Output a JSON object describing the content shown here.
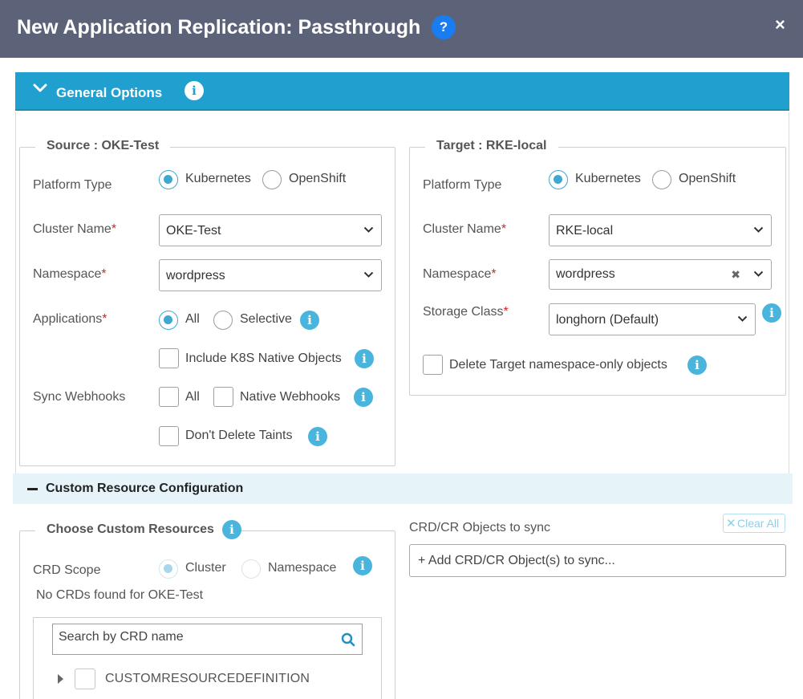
{
  "dialog": {
    "title": "New Application Replication: Passthrough",
    "help_glyph": "?",
    "close_glyph": "×"
  },
  "general_options": {
    "title": "General Options",
    "info_glyph": "i"
  },
  "source": {
    "legend": "Source : OKE-Test",
    "platform_type_label": "Platform Type",
    "platform_options": [
      "Kubernetes",
      "OpenShift"
    ],
    "platform_selected": "Kubernetes",
    "cluster_name_label": "Cluster Name",
    "cluster_name_value": "OKE-Test",
    "namespace_label": "Namespace",
    "namespace_value": "wordpress",
    "applications_label": "Applications",
    "applications_options": [
      "All",
      "Selective"
    ],
    "applications_selected": "All",
    "include_native_label": "Include K8S Native Objects",
    "sync_webhooks_label": "Sync Webhooks",
    "sync_webhooks_all": "All",
    "sync_webhooks_native": "Native Webhooks",
    "dont_delete_taints_label": "Don't Delete Taints",
    "required_mark": "*"
  },
  "target": {
    "legend": "Target : RKE-local",
    "platform_type_label": "Platform Type",
    "platform_options": [
      "Kubernetes",
      "OpenShift"
    ],
    "platform_selected": "Kubernetes",
    "cluster_name_label": "Cluster Name",
    "cluster_name_value": "RKE-local",
    "namespace_label": "Namespace",
    "namespace_value": "wordpress",
    "namespace_clear_glyph": "✖",
    "storage_class_label": "Storage Class",
    "storage_class_value": "longhorn (Default)",
    "delete_target_only_label": "Delete Target namespace-only objects"
  },
  "custom_resource_config": {
    "title": "Custom Resource Configuration",
    "choose_legend": "Choose Custom Resources",
    "crd_scope_label": "CRD Scope",
    "crd_scope_options": [
      "Cluster",
      "Namespace"
    ],
    "crd_scope_selected": "Cluster",
    "no_crds_text": "No CRDs found for OKE-Test",
    "search_placeholder": "Search by CRD name",
    "tree_items": [
      "CUSTOMRESOURCEDEFINITION"
    ],
    "objects_label": "CRD/CR Objects to sync",
    "clear_all_label": "Clear All",
    "add_objects_placeholder": "+ Add CRD/CR Object(s) to sync..."
  },
  "colors": {
    "titlebar": "#5c6378",
    "accent": "#1fa0cf",
    "help": "#1a7cf1",
    "info": "#4ab5dc",
    "required": "#e02020",
    "section_bg": "#e6f4fa"
  }
}
